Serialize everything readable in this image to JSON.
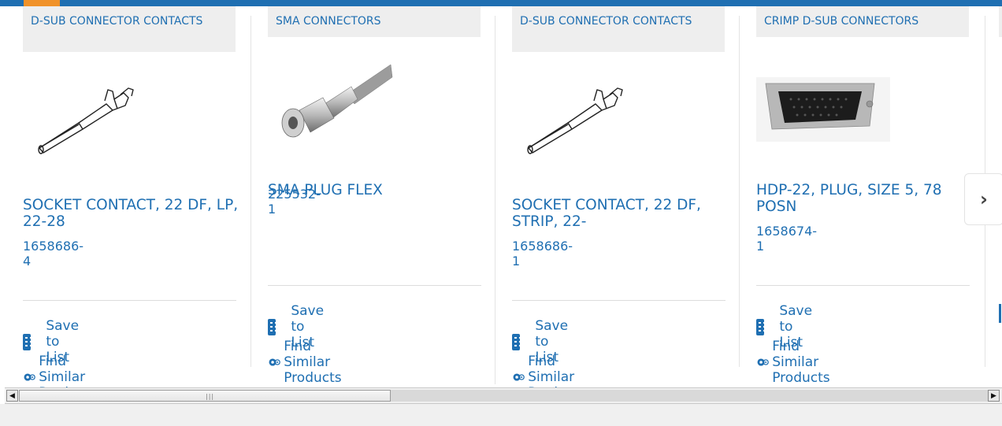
{
  "products": [
    {
      "category": "D-SUB CONNECTOR CONTACTS",
      "title": "SOCKET CONTACT, 22 DF, LP, 22-28",
      "part_number": "1658686-4",
      "save_label": "Save to List",
      "similar_label": "Find Similar Products",
      "image": "socket-contact"
    },
    {
      "category": "SMA CONNECTORS",
      "title": "SMA PLUG FLEX",
      "part_number": "225532-1",
      "save_label": "Save to List",
      "similar_label": "Find Similar Products",
      "image": "sma-plug-cable"
    },
    {
      "category": "D-SUB CONNECTOR CONTACTS",
      "title": "SOCKET CONTACT, 22 DF, STRIP, 22-",
      "part_number": "1658686-1",
      "save_label": "Save to List",
      "similar_label": "Find Similar Products",
      "image": "socket-contact"
    },
    {
      "category": "CRIMP D-SUB CONNECTORS",
      "title": "HDP-22, PLUG, SIZE 5, 78 POSN",
      "part_number": "1658674-1",
      "save_label": "Save to List",
      "similar_label": "Find Similar Products",
      "image": "dsub-plug"
    }
  ],
  "carousel": {
    "next_icon": "chevron-right-icon",
    "next_symbol": "›"
  },
  "colors": {
    "brand_blue": "#1f6fb2",
    "accent_orange": "#f0922a",
    "category_bg": "#eeeeee"
  },
  "scrollbar": {
    "left_arrow": "◀",
    "right_arrow": "▶",
    "grip": "|||"
  }
}
